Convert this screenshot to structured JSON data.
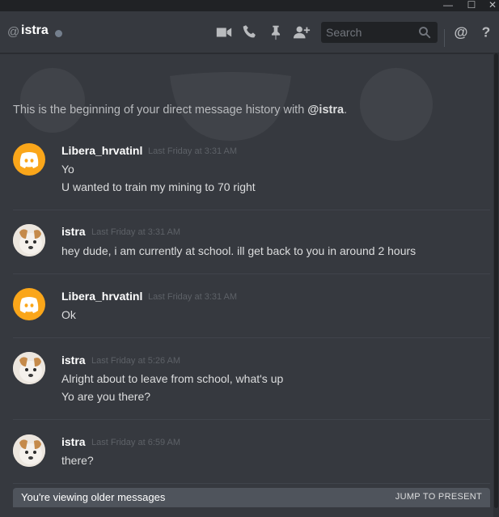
{
  "window": {
    "minimize_glyph": "—",
    "maximize_glyph": "☐",
    "close_glyph": "✕"
  },
  "header": {
    "at_symbol": "@",
    "channel_name": "istra",
    "status": "offline",
    "icons": [
      "video-call-icon",
      "voice-call-icon",
      "pin-icon",
      "add-friend-icon",
      "mention-icon",
      "help-icon"
    ],
    "search_placeholder": "Search",
    "mention_glyph": "@",
    "help_glyph": "?"
  },
  "intro": {
    "prefix": "This is the beginning of your direct message history with ",
    "user": "@istra",
    "suffix": "."
  },
  "messages": [
    {
      "author": "Libera_hrvatinl",
      "timestamp": "Last Friday at 3:31 AM",
      "avatar": "discord-default",
      "lines": [
        "Yo",
        "U wanted to train my mining to 70 right"
      ]
    },
    {
      "author": "istra",
      "timestamp": "Last Friday at 3:31 AM",
      "avatar": "dog",
      "lines": [
        "hey dude, i am currently at school. ill get back to you in around 2 hours"
      ]
    },
    {
      "author": "Libera_hrvatinl",
      "timestamp": "Last Friday at 3:31 AM",
      "avatar": "discord-default",
      "lines": [
        "Ok"
      ]
    },
    {
      "author": "istra",
      "timestamp": "Last Friday at 5:26 AM",
      "avatar": "dog",
      "lines": [
        "Alright about to leave from school, what's up",
        "Yo are you there?"
      ]
    },
    {
      "author": "istra",
      "timestamp": "Last Friday at 6:59 AM",
      "avatar": "dog",
      "lines": [
        "there?"
      ]
    }
  ],
  "older_bar": {
    "label": "You're viewing older messages",
    "jump": "JUMP TO PRESENT"
  },
  "colors": {
    "background": "#36393f",
    "discord_orange": "#faa61a",
    "text": "#dcddde"
  }
}
